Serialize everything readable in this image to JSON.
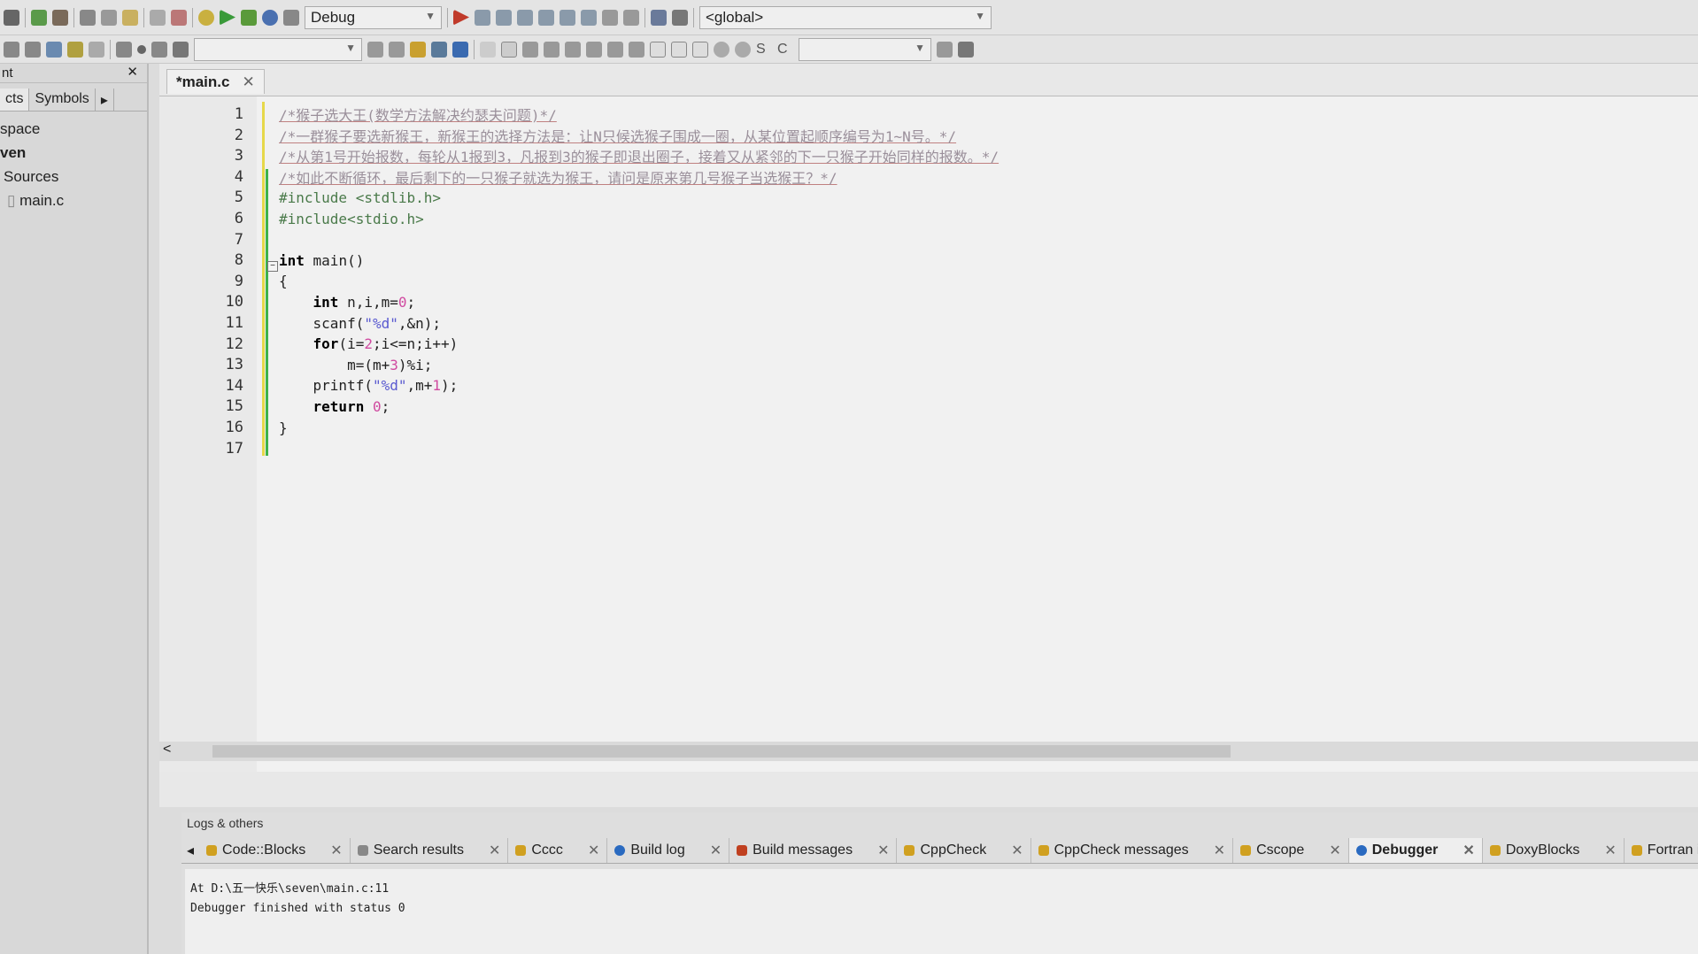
{
  "toolbar": {
    "build_target": "Debug",
    "scope": "<global>",
    "search": "",
    "symbol": ""
  },
  "left_panel": {
    "header": "nt",
    "tabs": [
      "cts",
      "Symbols"
    ],
    "tree": [
      "space",
      "ven",
      "Sources",
      "main.c"
    ]
  },
  "editor": {
    "tab": "*main.c",
    "lines": [
      [
        {
          "t": "/*猴子选大王(数学方法解决约瑟夫问题)*/",
          "c": "cm"
        }
      ],
      [
        {
          "t": "/*一群猴子要选新猴王，新猴王的选择方法是：让N只候选猴子围成一圈，从某位置起顺序编号为1~N号。*/",
          "c": "cm"
        }
      ],
      [
        {
          "t": "/*从第1号开始报数，每轮从1报到3，凡报到3的猴子即退出圈子，接着又从紧邻的下一只猴子开始同样的报数。*/",
          "c": "cm"
        }
      ],
      [
        {
          "t": "/*如此不断循环，最后剩下的一只猴子就选为猴王，请问是原来第几号猴子当选猴王？*/",
          "c": "cm"
        }
      ],
      [
        {
          "t": "#include <stdlib.h>",
          "c": "pp"
        }
      ],
      [
        {
          "t": "#include<stdio.h>",
          "c": "pp"
        }
      ],
      [],
      [
        {
          "t": "int",
          "c": "kw"
        },
        {
          "t": " main()",
          "c": ""
        }
      ],
      [
        {
          "t": "{",
          "c": ""
        }
      ],
      [
        {
          "t": "    ",
          "c": ""
        },
        {
          "t": "int",
          "c": "kw"
        },
        {
          "t": " n,i,m=",
          "c": ""
        },
        {
          "t": "0",
          "c": "nm"
        },
        {
          "t": ";",
          "c": ""
        }
      ],
      [
        {
          "t": "    scanf(",
          "c": ""
        },
        {
          "t": "\"%d\"",
          "c": "st"
        },
        {
          "t": ",&n);",
          "c": ""
        }
      ],
      [
        {
          "t": "    ",
          "c": ""
        },
        {
          "t": "for",
          "c": "kw"
        },
        {
          "t": "(i=",
          "c": ""
        },
        {
          "t": "2",
          "c": "nm"
        },
        {
          "t": ";i<=n;i++)",
          "c": ""
        }
      ],
      [
        {
          "t": "        m=(m+",
          "c": ""
        },
        {
          "t": "3",
          "c": "nm"
        },
        {
          "t": ")%i;",
          "c": ""
        }
      ],
      [
        {
          "t": "    printf(",
          "c": ""
        },
        {
          "t": "\"%d\"",
          "c": "st"
        },
        {
          "t": ",m+",
          "c": ""
        },
        {
          "t": "1",
          "c": "nm"
        },
        {
          "t": ");",
          "c": ""
        }
      ],
      [
        {
          "t": "    ",
          "c": ""
        },
        {
          "t": "return",
          "c": "kw"
        },
        {
          "t": " ",
          "c": ""
        },
        {
          "t": "0",
          "c": "nm"
        },
        {
          "t": ";",
          "c": ""
        }
      ],
      [
        {
          "t": "}",
          "c": ""
        }
      ],
      []
    ]
  },
  "logs": {
    "title": "Logs & others",
    "tabs": [
      {
        "label": "Code::Blocks",
        "icon": "codeblocks-icon"
      },
      {
        "label": "Search results",
        "icon": "search-icon"
      },
      {
        "label": "Cccc",
        "icon": "codeblocks-icon"
      },
      {
        "label": "Build log",
        "icon": "gear-icon"
      },
      {
        "label": "Build messages",
        "icon": "build-icon"
      },
      {
        "label": "CppCheck",
        "icon": "codeblocks-icon"
      },
      {
        "label": "CppCheck messages",
        "icon": "codeblocks-icon"
      },
      {
        "label": "Cscope",
        "icon": "codeblocks-icon"
      },
      {
        "label": "Debugger",
        "icon": "gear-icon",
        "active": true
      },
      {
        "label": "DoxyBlocks",
        "icon": "codeblocks-icon"
      },
      {
        "label": "Fortran inf",
        "icon": "codeblocks-icon"
      }
    ],
    "output": [
      "At D:\\五一快乐\\seven\\main.c:11",
      "Debugger finished with status 0"
    ]
  }
}
